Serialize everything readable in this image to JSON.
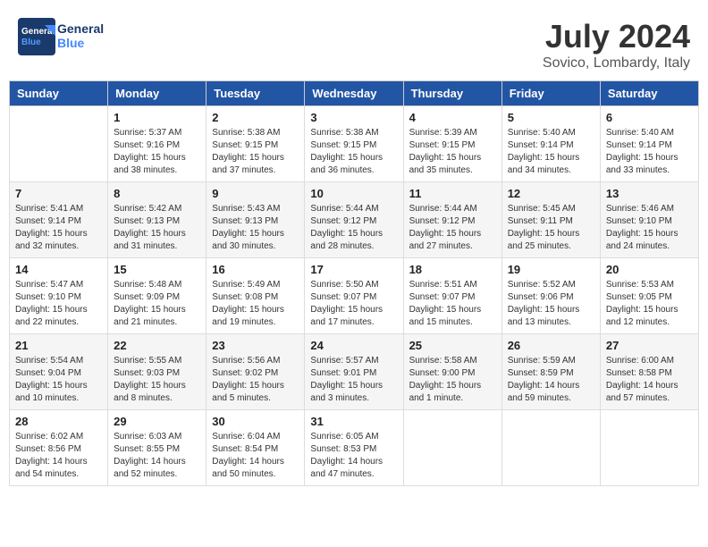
{
  "header": {
    "logo_text_general": "General",
    "logo_text_blue": "Blue",
    "month_year": "July 2024",
    "location": "Sovico, Lombardy, Italy"
  },
  "columns": [
    "Sunday",
    "Monday",
    "Tuesday",
    "Wednesday",
    "Thursday",
    "Friday",
    "Saturday"
  ],
  "weeks": [
    [
      {
        "day": "",
        "content": ""
      },
      {
        "day": "1",
        "content": "Sunrise: 5:37 AM\nSunset: 9:16 PM\nDaylight: 15 hours\nand 38 minutes."
      },
      {
        "day": "2",
        "content": "Sunrise: 5:38 AM\nSunset: 9:15 PM\nDaylight: 15 hours\nand 37 minutes."
      },
      {
        "day": "3",
        "content": "Sunrise: 5:38 AM\nSunset: 9:15 PM\nDaylight: 15 hours\nand 36 minutes."
      },
      {
        "day": "4",
        "content": "Sunrise: 5:39 AM\nSunset: 9:15 PM\nDaylight: 15 hours\nand 35 minutes."
      },
      {
        "day": "5",
        "content": "Sunrise: 5:40 AM\nSunset: 9:14 PM\nDaylight: 15 hours\nand 34 minutes."
      },
      {
        "day": "6",
        "content": "Sunrise: 5:40 AM\nSunset: 9:14 PM\nDaylight: 15 hours\nand 33 minutes."
      }
    ],
    [
      {
        "day": "7",
        "content": "Sunrise: 5:41 AM\nSunset: 9:14 PM\nDaylight: 15 hours\nand 32 minutes."
      },
      {
        "day": "8",
        "content": "Sunrise: 5:42 AM\nSunset: 9:13 PM\nDaylight: 15 hours\nand 31 minutes."
      },
      {
        "day": "9",
        "content": "Sunrise: 5:43 AM\nSunset: 9:13 PM\nDaylight: 15 hours\nand 30 minutes."
      },
      {
        "day": "10",
        "content": "Sunrise: 5:44 AM\nSunset: 9:12 PM\nDaylight: 15 hours\nand 28 minutes."
      },
      {
        "day": "11",
        "content": "Sunrise: 5:44 AM\nSunset: 9:12 PM\nDaylight: 15 hours\nand 27 minutes."
      },
      {
        "day": "12",
        "content": "Sunrise: 5:45 AM\nSunset: 9:11 PM\nDaylight: 15 hours\nand 25 minutes."
      },
      {
        "day": "13",
        "content": "Sunrise: 5:46 AM\nSunset: 9:10 PM\nDaylight: 15 hours\nand 24 minutes."
      }
    ],
    [
      {
        "day": "14",
        "content": "Sunrise: 5:47 AM\nSunset: 9:10 PM\nDaylight: 15 hours\nand 22 minutes."
      },
      {
        "day": "15",
        "content": "Sunrise: 5:48 AM\nSunset: 9:09 PM\nDaylight: 15 hours\nand 21 minutes."
      },
      {
        "day": "16",
        "content": "Sunrise: 5:49 AM\nSunset: 9:08 PM\nDaylight: 15 hours\nand 19 minutes."
      },
      {
        "day": "17",
        "content": "Sunrise: 5:50 AM\nSunset: 9:07 PM\nDaylight: 15 hours\nand 17 minutes."
      },
      {
        "day": "18",
        "content": "Sunrise: 5:51 AM\nSunset: 9:07 PM\nDaylight: 15 hours\nand 15 minutes."
      },
      {
        "day": "19",
        "content": "Sunrise: 5:52 AM\nSunset: 9:06 PM\nDaylight: 15 hours\nand 13 minutes."
      },
      {
        "day": "20",
        "content": "Sunrise: 5:53 AM\nSunset: 9:05 PM\nDaylight: 15 hours\nand 12 minutes."
      }
    ],
    [
      {
        "day": "21",
        "content": "Sunrise: 5:54 AM\nSunset: 9:04 PM\nDaylight: 15 hours\nand 10 minutes."
      },
      {
        "day": "22",
        "content": "Sunrise: 5:55 AM\nSunset: 9:03 PM\nDaylight: 15 hours\nand 8 minutes."
      },
      {
        "day": "23",
        "content": "Sunrise: 5:56 AM\nSunset: 9:02 PM\nDaylight: 15 hours\nand 5 minutes."
      },
      {
        "day": "24",
        "content": "Sunrise: 5:57 AM\nSunset: 9:01 PM\nDaylight: 15 hours\nand 3 minutes."
      },
      {
        "day": "25",
        "content": "Sunrise: 5:58 AM\nSunset: 9:00 PM\nDaylight: 15 hours\nand 1 minute."
      },
      {
        "day": "26",
        "content": "Sunrise: 5:59 AM\nSunset: 8:59 PM\nDaylight: 14 hours\nand 59 minutes."
      },
      {
        "day": "27",
        "content": "Sunrise: 6:00 AM\nSunset: 8:58 PM\nDaylight: 14 hours\nand 57 minutes."
      }
    ],
    [
      {
        "day": "28",
        "content": "Sunrise: 6:02 AM\nSunset: 8:56 PM\nDaylight: 14 hours\nand 54 minutes."
      },
      {
        "day": "29",
        "content": "Sunrise: 6:03 AM\nSunset: 8:55 PM\nDaylight: 14 hours\nand 52 minutes."
      },
      {
        "day": "30",
        "content": "Sunrise: 6:04 AM\nSunset: 8:54 PM\nDaylight: 14 hours\nand 50 minutes."
      },
      {
        "day": "31",
        "content": "Sunrise: 6:05 AM\nSunset: 8:53 PM\nDaylight: 14 hours\nand 47 minutes."
      },
      {
        "day": "",
        "content": ""
      },
      {
        "day": "",
        "content": ""
      },
      {
        "day": "",
        "content": ""
      }
    ]
  ]
}
